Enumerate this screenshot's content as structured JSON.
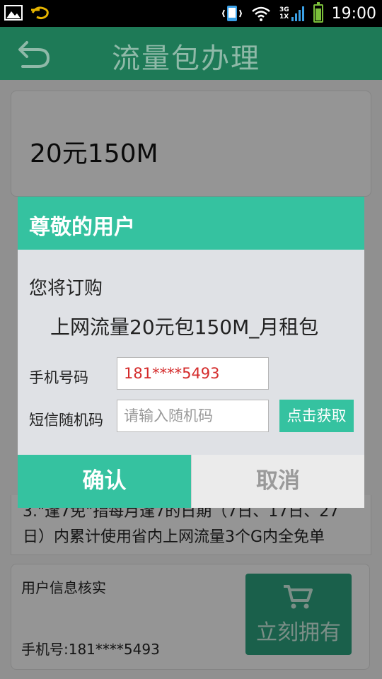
{
  "status_bar": {
    "network_top": "3G",
    "network_bottom": "1X",
    "time": "19:00"
  },
  "header": {
    "title": "流量包办理"
  },
  "page": {
    "package_price": "20元150M",
    "description_line1": "3.\"逢7免\"指每月逢7的日期（7日、17日、27",
    "description_line2": "日）内累计使用省内上网流量3个G内全免单",
    "verify_title": "用户信息核实",
    "verify_phone": "手机号:181****5493",
    "buy_button": "立刻拥有"
  },
  "dialog": {
    "title": "尊敬的用户",
    "intro": "您将订购",
    "product": "上网流量20元包150M_月租包",
    "phone_label": "手机号码",
    "phone_value": "181****5493",
    "code_label": "短信随机码",
    "code_placeholder": "请输入随机码",
    "get_code_button": "点击获取",
    "confirm_button": "确认",
    "cancel_button": "取消"
  },
  "colors": {
    "header_bg": "#1e7a57",
    "accent": "#35c2a0",
    "phone_text": "#d42b2b"
  }
}
